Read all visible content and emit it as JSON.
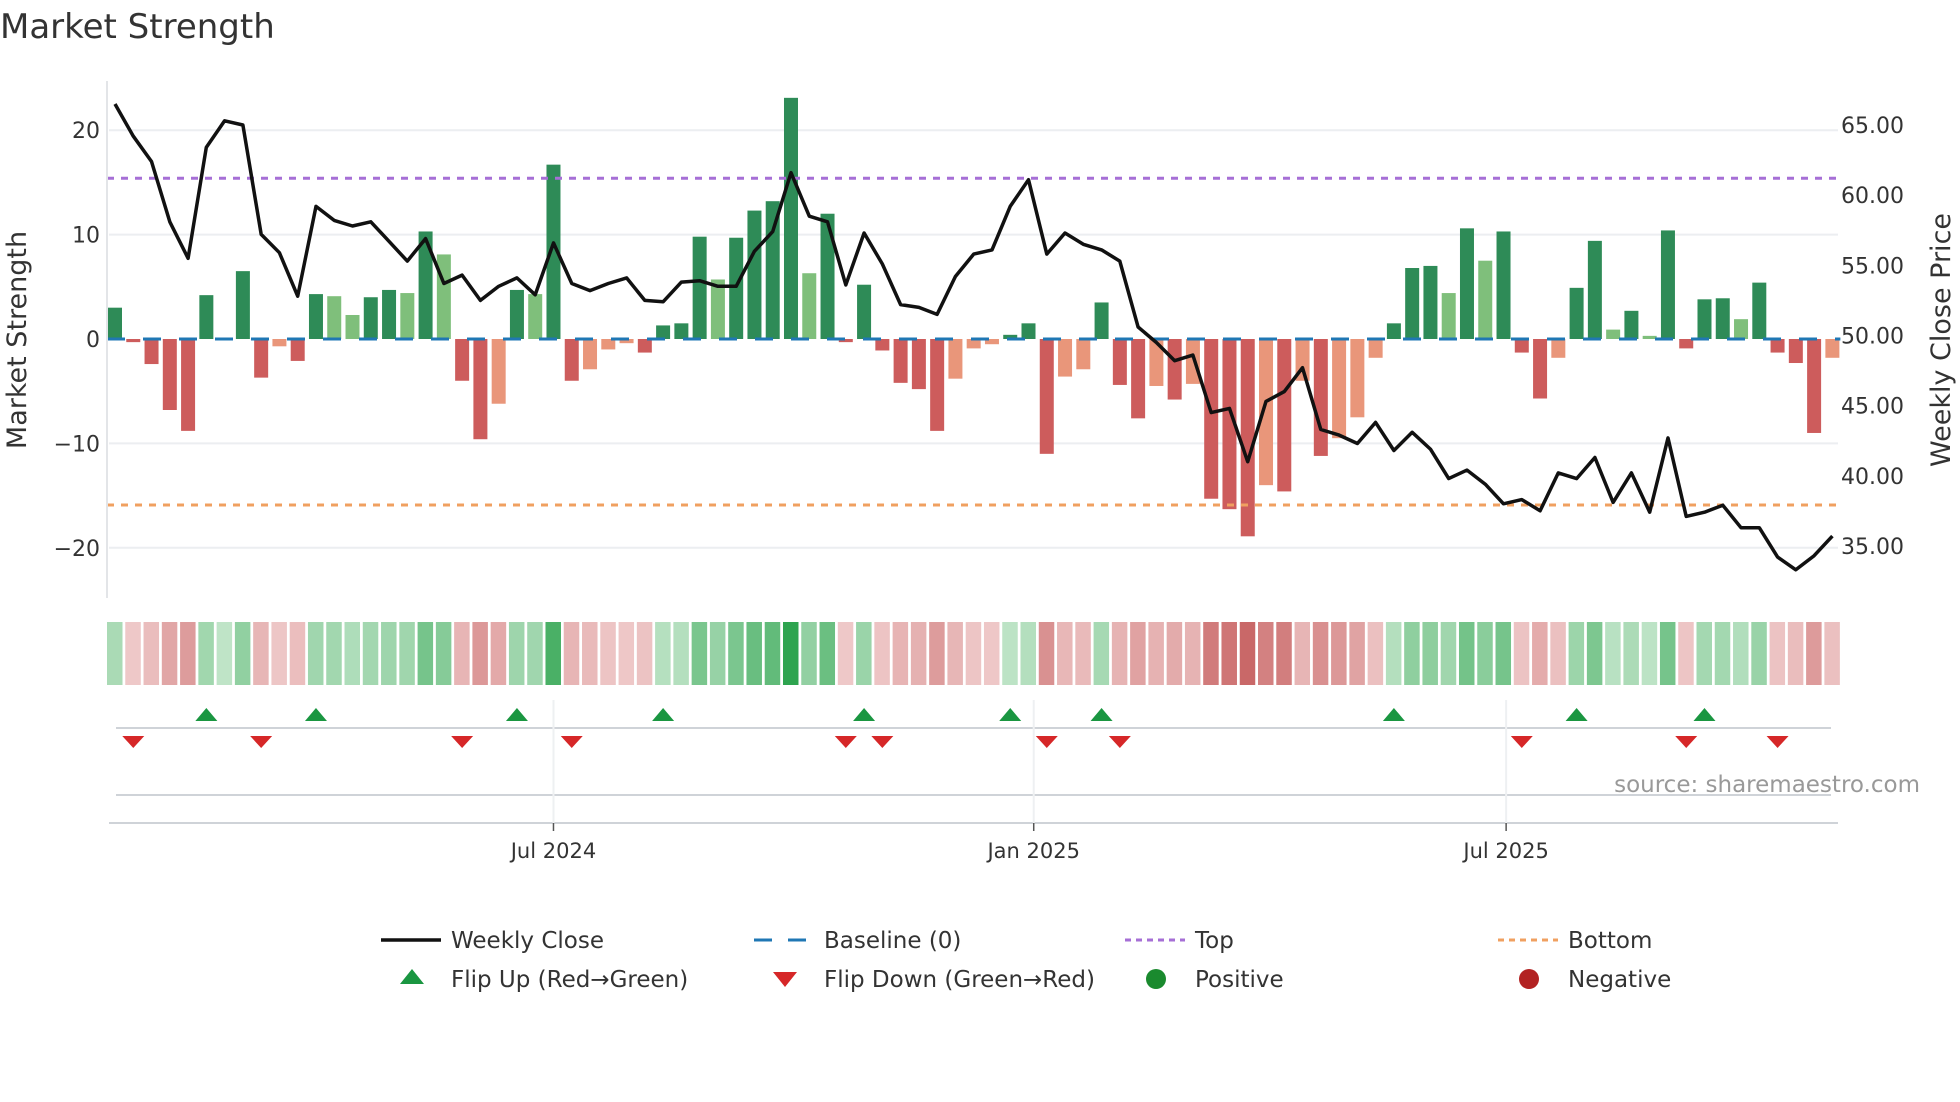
{
  "chart_data": {
    "type": "bar",
    "title": "Market Strength",
    "ylabel": "Market Strength",
    "y2label": "Weekly Close Price",
    "ylim": [
      -25,
      25
    ],
    "y2lim": [
      32,
      67
    ],
    "start_week": "2024-01-15",
    "frequency": "weekly",
    "yticks": [
      "20",
      "10",
      "0",
      "−10",
      "−20"
    ],
    "ytick_values": [
      20,
      10,
      0,
      -10,
      -20
    ],
    "y2ticks": [
      "65.00",
      "60.00",
      "55.00",
      "50.00",
      "45.00",
      "40.00",
      "35.00"
    ],
    "y2tick_values": [
      65,
      60,
      55,
      50,
      45,
      40,
      35
    ],
    "xticks": [
      {
        "label": "Jul 2024",
        "date": "2024-07-01"
      },
      {
        "label": "Jan 2025",
        "date": "2025-01-01"
      },
      {
        "label": "Jul 2025",
        "date": "2025-07-01"
      }
    ],
    "top_level": 15.4,
    "bottom_level": -15.9,
    "baseline": 0,
    "strength": [
      3.0,
      -0.3,
      -2.4,
      -6.8,
      -8.8,
      4.2,
      0,
      6.5,
      -3.7,
      -0.7,
      -2.1,
      4.3,
      4.1,
      2.3,
      4.0,
      4.7,
      4.4,
      10.3,
      8.1,
      -4.0,
      -9.6,
      -6.2,
      4.7,
      4.3,
      16.7,
      -4.0,
      -2.9,
      -1.0,
      -0.4,
      -1.3,
      1.3,
      1.5,
      9.8,
      5.7,
      9.7,
      12.3,
      13.2,
      23.1,
      6.3,
      12.0,
      -0.3,
      5.2,
      -1.1,
      -4.2,
      -4.8,
      -8.8,
      -3.8,
      -0.9,
      -0.5,
      0.4,
      1.5,
      -11.0,
      -3.6,
      -2.9,
      3.5,
      -4.4,
      -7.6,
      -4.5,
      -5.8,
      -4.3,
      -15.3,
      -16.3,
      -18.9,
      -14.0,
      -14.6,
      -4.0,
      -11.2,
      -9.5,
      -7.5,
      -1.8,
      1.5,
      6.8,
      7.0,
      4.4,
      10.6,
      7.5,
      10.3,
      -1.3,
      -5.7,
      -1.8,
      4.9,
      9.4,
      0.9,
      2.7,
      0.3,
      10.4,
      -0.9,
      3.8,
      3.9,
      1.9,
      5.4,
      -1.3,
      -2.3,
      -9.0,
      -1.8
    ],
    "weekly_close": [
      66.5,
      64.2,
      62.4,
      58.1,
      55.5,
      63.4,
      65.3,
      65.0,
      57.2,
      55.9,
      52.8,
      59.2,
      58.2,
      57.8,
      58.1,
      56.7,
      55.3,
      56.9,
      53.7,
      54.3,
      52.5,
      53.5,
      54.1,
      52.9,
      56.6,
      53.7,
      53.2,
      53.7,
      54.1,
      52.5,
      52.4,
      53.8,
      53.9,
      53.5,
      53.5,
      56.0,
      57.4,
      61.6,
      58.5,
      58.1,
      53.6,
      57.3,
      55.1,
      52.2,
      52.0,
      51.5,
      54.2,
      55.8,
      56.1,
      59.2,
      61.1,
      55.8,
      57.3,
      56.5,
      56.1,
      55.3,
      50.6,
      49.5,
      48.2,
      48.6,
      44.5,
      44.8,
      41.0,
      45.3,
      46.0,
      47.7,
      43.3,
      42.9,
      42.3,
      43.8,
      41.8,
      43.1,
      41.9,
      39.8,
      40.4,
      39.4,
      38.0,
      38.3,
      37.5,
      40.2,
      39.8,
      41.3,
      38.1,
      40.2,
      37.4,
      42.7,
      37.1,
      37.4,
      37.9,
      36.3,
      36.3,
      34.2,
      33.3,
      34.3,
      35.7
    ],
    "flip_up_indices": [
      5,
      11,
      22,
      30,
      41,
      49,
      54,
      70,
      80,
      87
    ],
    "flip_down_indices": [
      1,
      8,
      19,
      25,
      40,
      42,
      51,
      55,
      77,
      86,
      91
    ],
    "legend": {
      "position": "bottom",
      "entries": [
        {
          "label": "Weekly Close",
          "kind": "line"
        },
        {
          "label": "Baseline (0)",
          "kind": "dash"
        },
        {
          "label": "Top",
          "kind": "dot-purple"
        },
        {
          "label": "Bottom",
          "kind": "dot-orange"
        },
        {
          "label": "Flip Up (Red→Green)",
          "kind": "up"
        },
        {
          "label": "Flip Down (Green→Red)",
          "kind": "down"
        },
        {
          "label": "Positive",
          "kind": "pos"
        },
        {
          "label": "Negative",
          "kind": "neg"
        }
      ]
    },
    "source": "source: sharemaestro.com"
  },
  "colors": {
    "pos_strong": "#2e8b57",
    "pos_weak": "#7fbf7b",
    "neg_strong": "#cd5c5c",
    "neg_weak": "#e9967a",
    "baseline": "#1f77b4",
    "top": "#a66fd6",
    "bottom": "#f0a060",
    "close": "#111111",
    "flip_up": "#1a9641",
    "flip_down": "#d62728",
    "positive_dot": "#1a8a2e",
    "negative_dot": "#b22222"
  }
}
